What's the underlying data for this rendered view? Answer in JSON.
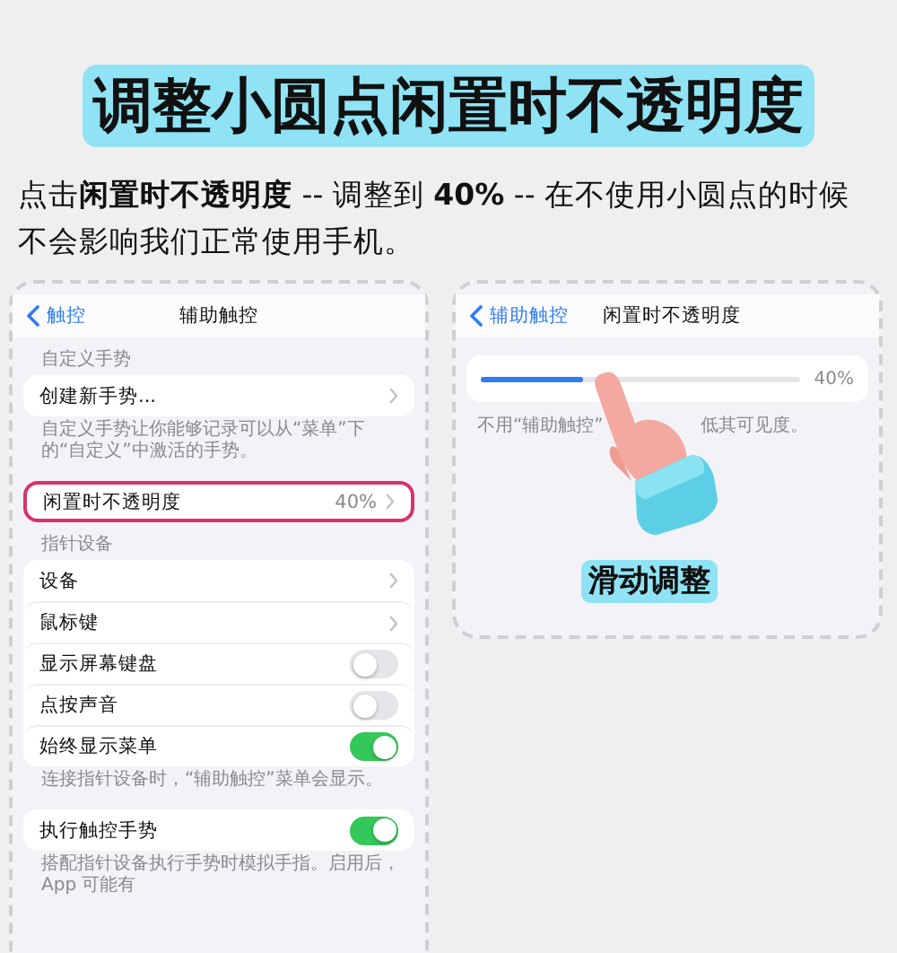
{
  "title": "调整小圆点闲置时不透明度",
  "intro": "点击**闲置时不透明度** -- 调整到 **40%** -- 在不使用小圆点的时候不会影响我们正常使用手机。",
  "left_screen": {
    "back": "触控",
    "title": "辅助触控",
    "sections": [
      {
        "header": "自定义手势",
        "rows": [
          {
            "kind": "link",
            "label": "创建新手势...",
            "highlighted": false
          }
        ],
        "footer": "自定义手势让你能够记录可以从“菜单”下的“自定义”中激活的手势。"
      },
      {
        "rows": [
          {
            "kind": "link",
            "label": "闲置时不透明度",
            "value": "40%",
            "highlighted": true
          }
        ]
      },
      {
        "header": "指针设备",
        "rows": [
          {
            "kind": "link",
            "label": "设备",
            "highlighted": false
          },
          {
            "kind": "link",
            "label": "鼠标键",
            "highlighted": false
          },
          {
            "kind": "toggle",
            "label": "显示屏幕键盘",
            "on": false
          },
          {
            "kind": "toggle",
            "label": "点按声音",
            "on": false
          },
          {
            "kind": "toggle",
            "label": "始终显示菜单",
            "on": true
          }
        ],
        "footer": "连接指针设备时，“辅助触控”菜单会显示。"
      },
      {
        "rows": [
          {
            "kind": "toggle",
            "label": "执行触控手势",
            "on": true
          }
        ],
        "footer": "搭配指针设备执行手势时模拟手指。启用后，App 可能有"
      }
    ]
  },
  "right_screen": {
    "back": "辅助触控",
    "title": "闲置时不透明度",
    "slider": {
      "level": 0.32,
      "reading": "40%"
    },
    "hint_parts": [
      "不用“辅助触控”",
      "低其可见度。"
    ],
    "caption": "滑动调整"
  }
}
